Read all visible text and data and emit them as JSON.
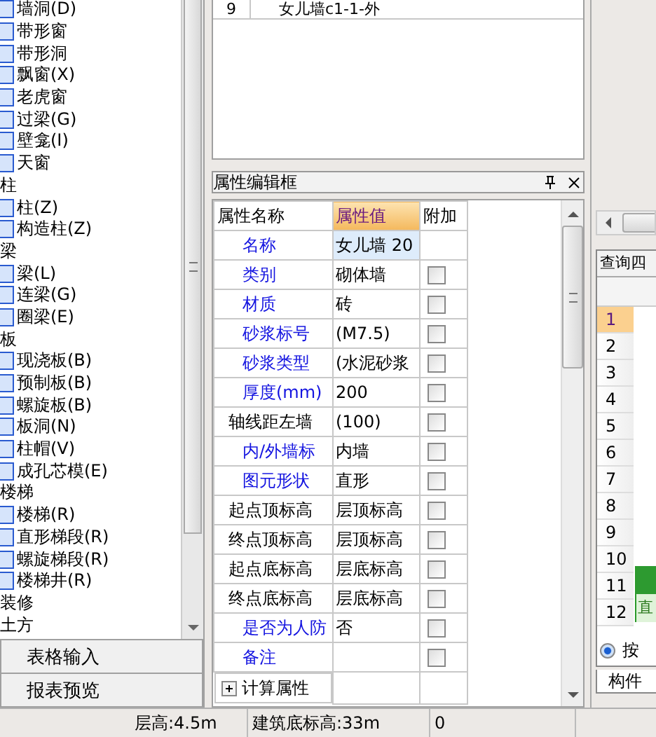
{
  "component_tree": {
    "items": [
      {
        "label": "墙洞(D)",
        "kind": "item"
      },
      {
        "label": "带形窗",
        "kind": "item"
      },
      {
        "label": "带形洞",
        "kind": "item"
      },
      {
        "label": "飘窗(X)",
        "kind": "item"
      },
      {
        "label": "老虎窗",
        "kind": "item"
      },
      {
        "label": "过梁(G)",
        "kind": "item"
      },
      {
        "label": "壁龛(I)",
        "kind": "item"
      },
      {
        "label": "天窗",
        "kind": "item"
      },
      {
        "label": "柱",
        "kind": "category"
      },
      {
        "label": "柱(Z)",
        "kind": "item"
      },
      {
        "label": "构造柱(Z)",
        "kind": "item"
      },
      {
        "label": "梁",
        "kind": "category"
      },
      {
        "label": "梁(L)",
        "kind": "item"
      },
      {
        "label": "连梁(G)",
        "kind": "item"
      },
      {
        "label": "圈梁(E)",
        "kind": "item"
      },
      {
        "label": "板",
        "kind": "category"
      },
      {
        "label": "现浇板(B)",
        "kind": "item"
      },
      {
        "label": "预制板(B)",
        "kind": "item"
      },
      {
        "label": "螺旋板(B)",
        "kind": "item"
      },
      {
        "label": "板洞(N)",
        "kind": "item"
      },
      {
        "label": "柱帽(V)",
        "kind": "item"
      },
      {
        "label": "成孔芯模(E)",
        "kind": "item"
      },
      {
        "label": "楼梯",
        "kind": "category"
      },
      {
        "label": "楼梯(R)",
        "kind": "item"
      },
      {
        "label": "直形梯段(R)",
        "kind": "item"
      },
      {
        "label": "螺旋梯段(R)",
        "kind": "item"
      },
      {
        "label": "楼梯井(R)",
        "kind": "item"
      },
      {
        "label": "装修",
        "kind": "category"
      },
      {
        "label": "土方",
        "kind": "category"
      }
    ]
  },
  "tree_buttons": [
    "表格输入",
    "报表预览"
  ],
  "component_list": {
    "rows": [
      {
        "number": "9",
        "name": "女儿墙c1-1-外"
      }
    ]
  },
  "property_panel": {
    "title": "属性编辑框",
    "columns": [
      "属性名称",
      "属性值",
      "附加"
    ],
    "rows": [
      {
        "kind": "property",
        "name": "名称",
        "value": "女儿墙 20",
        "public": true,
        "selected": true
      },
      {
        "kind": "property",
        "name": "类别",
        "value": "砌体墙",
        "public": true,
        "selected": false,
        "checked": false
      },
      {
        "kind": "property",
        "name": "材质",
        "value": "砖",
        "public": true,
        "selected": false,
        "checked": false
      },
      {
        "kind": "property",
        "name": "砂浆标号",
        "value": "(M7.5)",
        "public": true,
        "selected": false,
        "checked": false
      },
      {
        "kind": "property",
        "name": "砂浆类型",
        "value": "(水泥砂浆",
        "public": true,
        "selected": false,
        "checked": false
      },
      {
        "kind": "property",
        "name": "厚度(mm)",
        "value": "200",
        "public": true,
        "selected": false,
        "checked": false
      },
      {
        "kind": "property",
        "name": "轴线距左墙",
        "value": "(100)",
        "public": false,
        "selected": false,
        "checked": false
      },
      {
        "kind": "property",
        "name": "内/外墙标",
        "value": "内墙",
        "public": true,
        "selected": false,
        "checked": false
      },
      {
        "kind": "property",
        "name": "图元形状",
        "value": "直形",
        "public": true,
        "selected": false,
        "checked": false
      },
      {
        "kind": "property",
        "name": "起点顶标高",
        "value": "层顶标高",
        "public": false,
        "selected": false,
        "checked": false
      },
      {
        "kind": "property",
        "name": "终点顶标高",
        "value": "层顶标高",
        "public": false,
        "selected": false,
        "checked": false
      },
      {
        "kind": "property",
        "name": "起点底标高",
        "value": "层底标高",
        "public": false,
        "selected": false,
        "checked": false
      },
      {
        "kind": "property",
        "name": "终点底标高",
        "value": "层底标高",
        "public": false,
        "selected": false,
        "checked": false
      },
      {
        "kind": "property",
        "name": "是否为人防",
        "value": "否",
        "public": true,
        "selected": false,
        "checked": false
      },
      {
        "kind": "property",
        "name": "备注",
        "value": "",
        "public": true,
        "selected": false,
        "checked": false
      },
      {
        "kind": "group",
        "name": "计算属性",
        "expanded": false
      }
    ]
  },
  "query_panel": {
    "title": "查询四",
    "rows": [
      {
        "number": "1",
        "selected": true
      },
      {
        "number": "2",
        "selected": false
      },
      {
        "number": "3",
        "selected": false
      },
      {
        "number": "4",
        "selected": false
      },
      {
        "number": "5",
        "selected": false
      },
      {
        "number": "6",
        "selected": false
      },
      {
        "number": "7",
        "selected": false
      },
      {
        "number": "8",
        "selected": false
      },
      {
        "number": "9",
        "selected": false
      },
      {
        "number": "10",
        "selected": false
      },
      {
        "number": "11",
        "selected": false
      },
      {
        "number": "12",
        "selected": false
      }
    ],
    "popup_text": "直",
    "radio": {
      "label": "按",
      "selected": true
    },
    "tab": "构件"
  },
  "status_bar": [
    "层高:4.5m",
    "建筑底标高:33m",
    "0"
  ]
}
